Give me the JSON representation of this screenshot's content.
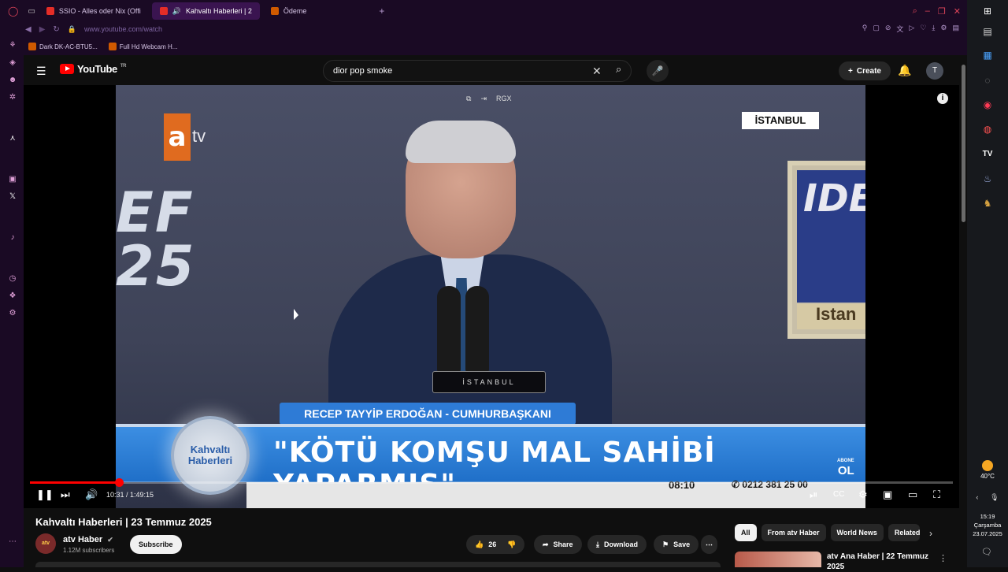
{
  "browser": {
    "tabs": [
      {
        "label": "SSIO - Alles oder Nix (Offi",
        "active": false,
        "favicon": "youtube"
      },
      {
        "label": "Kahvaltı Haberleri | 2",
        "active": true,
        "favicon": "youtube"
      },
      {
        "label": "Ödeme",
        "active": false,
        "favicon": "hb"
      }
    ],
    "new_tab": "+",
    "url": "www.youtube.com/watch",
    "bookmarks": [
      "Dark DK-AC-BTU5...",
      "Full Hd Webcam H..."
    ],
    "accent": "#1a0a24"
  },
  "youtube": {
    "logo_text": "YouTube",
    "region": "TR",
    "search_query": "dior pop smoke",
    "create_label": "Create",
    "avatar_letter": "T"
  },
  "video": {
    "channel_logo_letter": "a",
    "channel_logo_suffix": "tv",
    "event_text_1": "EF",
    "event_text_2": "25",
    "city_badge": "İSTANBUL",
    "lectern_label": "İSTANBUL",
    "banner_text": "IDE",
    "banner_bottom": "Istan",
    "overlay_badge": "RGX",
    "speaker_strip": "RECEP TAYYİP ERDOĞAN - CUMHURBAŞKANI",
    "headline": "\"KÖTÜ KOMŞU MAL SAHİBİ YAPARMIŞ\"",
    "show_badge_line1": "Kahvaltı",
    "show_badge_line2": "Haberleri",
    "on_screen_clock": "08:10",
    "phone": "0212 381 25 00",
    "abone_line1": "ABONE",
    "abone_line2": "OL"
  },
  "player": {
    "current_time": "10:31",
    "duration": "1:49:15",
    "time_display": "10:31 / 1:49:15",
    "progress_fraction": 0.096
  },
  "watch": {
    "title": "Kahvaltı Haberleri | 23 Temmuz 2025",
    "channel_name": "atv Haber",
    "subscribers": "1.12M subscribers",
    "subscribe_label": "Subscribe",
    "likes": "26",
    "share_label": "Share",
    "download_label": "Download",
    "save_label": "Save"
  },
  "sidebar": {
    "chips": [
      "All",
      "From atv Haber",
      "World News",
      "Related"
    ],
    "recommendation_title": "atv Ana Haber | 22 Temmuz 2025"
  },
  "taskbar": {
    "temperature": "40°C",
    "time": "15:19",
    "day": "Çarşamba",
    "date": "23.07.2025"
  }
}
